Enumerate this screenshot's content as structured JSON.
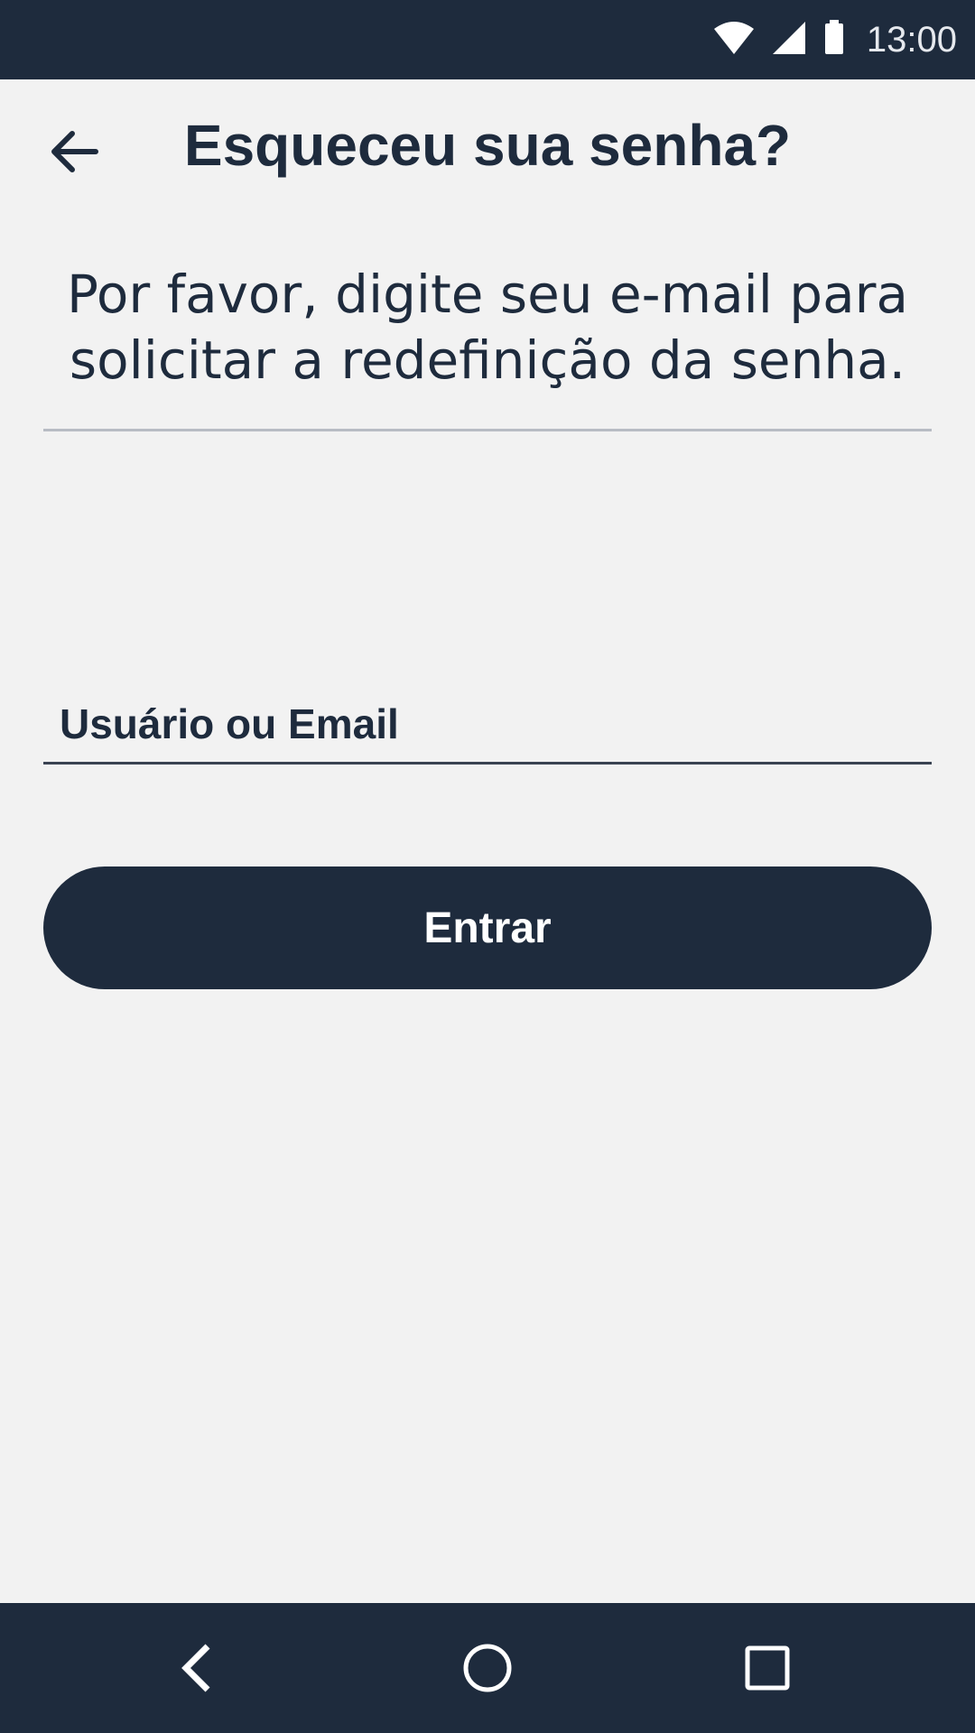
{
  "status_bar": {
    "time": "13:00",
    "icons": [
      "wifi-icon",
      "cell-signal-icon",
      "battery-icon"
    ]
  },
  "app_bar": {
    "title": "Esqueceu sua senha?",
    "back_icon": "arrow-left-icon"
  },
  "instruction": {
    "line1": "Por favor, digite seu e-mail para",
    "line2": "solicitar a redefinição da senha."
  },
  "form": {
    "username_placeholder": "Usuário ou Email",
    "username_value": "",
    "submit_label": "Entrar"
  },
  "nav_bar": {
    "icons": [
      "nav-back-icon",
      "nav-home-icon",
      "nav-recents-icon"
    ]
  },
  "colors": {
    "primary": "#1e2b3d",
    "background": "#f2f2f2",
    "divider": "#b8bcc4",
    "on_primary": "#ffffff"
  }
}
